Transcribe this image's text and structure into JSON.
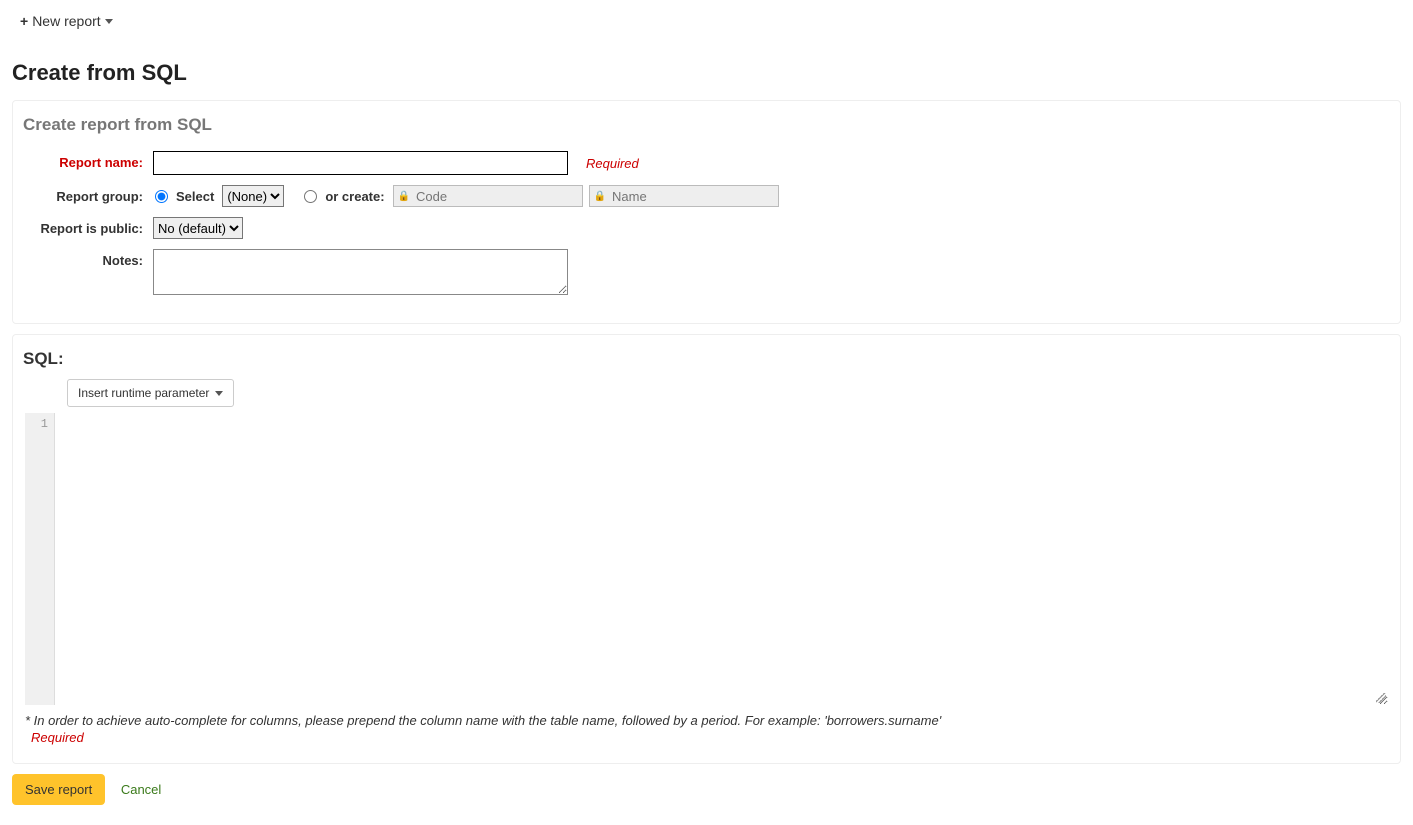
{
  "toolbar": {
    "new_report_label": "New report"
  },
  "page": {
    "title": "Create from SQL"
  },
  "form_panel": {
    "heading": "Create report from SQL",
    "labels": {
      "report_name": "Report name:",
      "report_group": "Report group:",
      "report_is_public": "Report is public:",
      "notes": "Notes:"
    },
    "fields": {
      "report_name_value": "",
      "required_hint": "Required",
      "group_select_label": "Select",
      "group_select_value": "(None)",
      "group_create_label": "or create:",
      "group_code_placeholder": "Code",
      "group_name_placeholder": "Name",
      "public_value": "No (default)",
      "notes_value": ""
    }
  },
  "sql_panel": {
    "heading": "SQL:",
    "insert_param_label": "Insert runtime parameter",
    "gutter_lines": [
      "1"
    ],
    "footnote": "* In order to achieve auto-complete for columns, please prepend the column name with the table name, followed by a period. For example: 'borrowers.surname'",
    "required_hint": "Required"
  },
  "actions": {
    "save_label": "Save report",
    "cancel_label": "Cancel"
  }
}
